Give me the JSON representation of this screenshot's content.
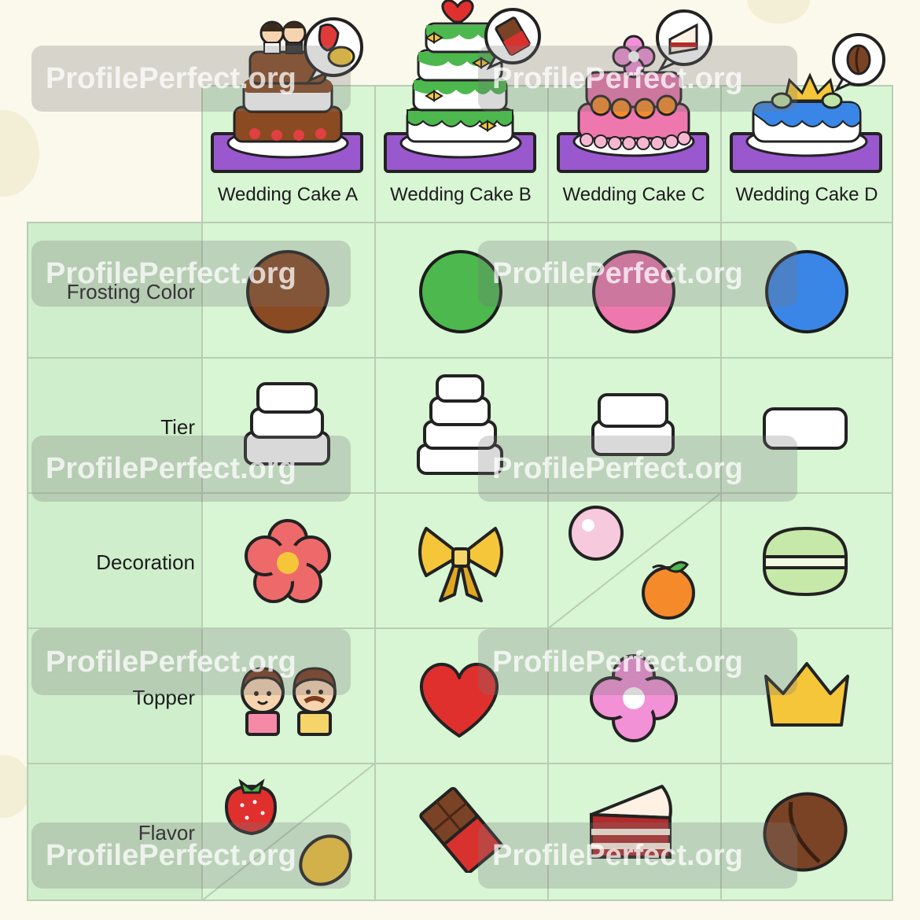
{
  "columns": [
    {
      "label": "Wedding Cake A",
      "frosting_color": "#8a4a22"
    },
    {
      "label": "Wedding Cake B",
      "frosting_color": "#4cb84e"
    },
    {
      "label": "Wedding Cake C",
      "frosting_color": "#ee78ad"
    },
    {
      "label": "Wedding Cake D",
      "frosting_color": "#3a86e6"
    }
  ],
  "rows": [
    {
      "label": "Frosting Color"
    },
    {
      "label": "Tier",
      "values": [
        3,
        4,
        2,
        1
      ]
    },
    {
      "label": "Decoration",
      "values": [
        "flower-icon",
        "bow-icon",
        "pearl-and-orange-icon",
        "macaron-icon"
      ]
    },
    {
      "label": "Topper",
      "values": [
        "couple-icon",
        "heart-icon",
        "flower-icon",
        "crown-icon"
      ]
    },
    {
      "label": "Flavor",
      "values": [
        "strawberry-and-lemon-icon",
        "chocolate-bar-icon",
        "red-velvet-slice-icon",
        "coffee-bean-icon"
      ]
    }
  ],
  "watermark": "ProfilePerfect.org",
  "colors": {
    "background": "#fbf9ec",
    "cell": "#d8f5d4",
    "border": "#b9cdb3",
    "plate": "#9a58cf"
  }
}
